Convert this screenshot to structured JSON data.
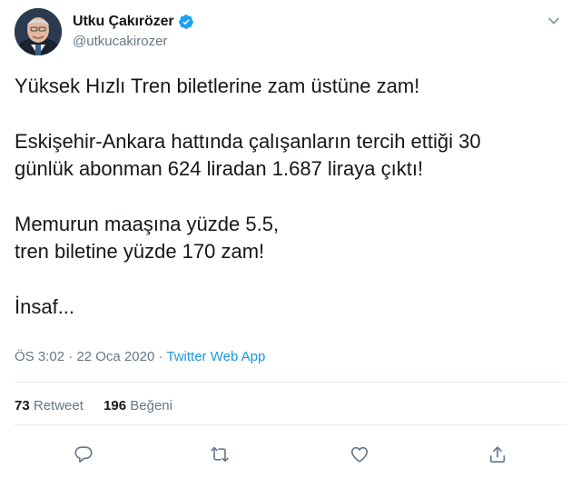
{
  "user": {
    "display_name": "Utku Çakırözer",
    "handle": "@utkucakirozer",
    "verified": true
  },
  "tweet": {
    "paragraphs": [
      [
        "Yüksek Hızlı Tren biletlerine zam üstüne zam!"
      ],
      [
        "Eskişehir-Ankara hattında çalışanların tercih ettiği 30",
        "günlük abonman 624 liradan 1.687 liraya çıktı!"
      ],
      [
        "Memurun maaşına yüzde 5.5,",
        "tren biletine yüzde 170 zam!"
      ],
      [
        "İnsaf..."
      ]
    ],
    "time": "ÖS 3:02",
    "separator": "·",
    "date": "22 Oca 2020",
    "source": "Twitter Web App"
  },
  "stats": {
    "retweet_count": "73",
    "retweet_label": "Retweet",
    "like_count": "196",
    "like_label": "Beğeni"
  },
  "icons": {
    "reply": "reply-icon",
    "retweet": "retweet-icon",
    "like": "heart-icon",
    "share": "share-icon",
    "caret": "chevron-down-icon",
    "verified": "verified-badge-icon"
  },
  "colors": {
    "accent": "#1da1f2",
    "link": "#1b95e0",
    "secondary_text": "#657786",
    "primary_text": "#14171a"
  }
}
